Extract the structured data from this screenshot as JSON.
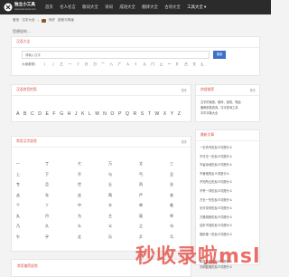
{
  "header": {
    "logo_text": "独立小工具",
    "logo_sub": "www.duli.tools.com",
    "nav": [
      "首页",
      "名人名言",
      "歌词大全",
      "诗词",
      "成语大全",
      "翻译大全",
      "古诗大全",
      "工具大全 ▾"
    ],
    "logo_icon": "tool-logo-icon"
  },
  "breadcrumb": {
    "home": "首页",
    "sep1": "汉字大全",
    "sep2": "›",
    "current": "汉字大全",
    "flag_label": "你好",
    "page": "部首与笔画"
  },
  "welcome": "您想说的…",
  "search_card": {
    "title": "汉语大全",
    "placeholder": "请输入汉字",
    "button": "搜索",
    "radical_label": "大家都搜：",
    "radicals": [
      "丨",
      "丿",
      "乙",
      "一",
      "丫",
      "乃",
      "刀",
      "亠",
      "八",
      "广",
      "人",
      "亻",
      "儿",
      "冂",
      "凵",
      "冖",
      "阝",
      "己",
      "又",
      "廴"
    ]
  },
  "pinyin_card": {
    "title": "汉语拼音检索",
    "more": "更多",
    "letters": [
      "A",
      "B",
      "C",
      "D",
      "E",
      "F",
      "G",
      "H",
      "J",
      "K",
      "L",
      "M",
      "N",
      "O",
      "P",
      "Q",
      "R",
      "S",
      "T",
      "W",
      "X",
      "Y",
      "Z"
    ]
  },
  "radical_card": {
    "title": "常用汉字部首",
    "more": "更多",
    "rows": [
      [
        "一",
        "丁",
        "七",
        "万",
        "丈",
        "三"
      ],
      [
        "上",
        "下",
        "不",
        "与",
        "丐",
        "丑"
      ],
      [
        "专",
        "且",
        "世",
        "丘",
        "丙",
        "业"
      ],
      [
        "丛",
        "东",
        "丝",
        "两",
        "严",
        "丧"
      ],
      [
        "个",
        "丫",
        "中",
        "丰",
        "串",
        "临"
      ],
      [
        "丸",
        "丹",
        "为",
        "主",
        "丽",
        "举"
      ],
      [
        "乃",
        "久",
        "么",
        "义",
        "之",
        "乌"
      ],
      [
        "乍",
        "乎",
        "乏",
        "乐",
        "乒",
        "乓"
      ]
    ]
  },
  "side_top": {
    "title": "热搜推荐",
    "more": "更多",
    "items": [
      "文字的读音，繁体，部首，笔画",
      "偏旁部首查询，汉字查询工具",
      "中华字典大全"
    ]
  },
  "side_list": {
    "title": "最新文章",
    "items": [
      "一石杀鸟的反义词是什么",
      "不可无一的反义词是什么",
      "不留余地的反义词是什么",
      "不管他的反义词是什么",
      "不知所云的反义词是什么",
      "不赞一词的反义词是什么",
      "万无一失的反义词是什么",
      "无可奈何的反义词是什么",
      "万籁俱寂的反义词是什么",
      "百折不挠的反义词是什么",
      "惟精惟一的反义词是什么"
    ],
    "bottom_items": [
      "和风细雨的反义词是什么",
      "光明磊落的反义词是什么"
    ]
  },
  "bottom_card": {
    "title": "常用偏旁部首"
  },
  "watermark": "秒收录啦msl"
}
